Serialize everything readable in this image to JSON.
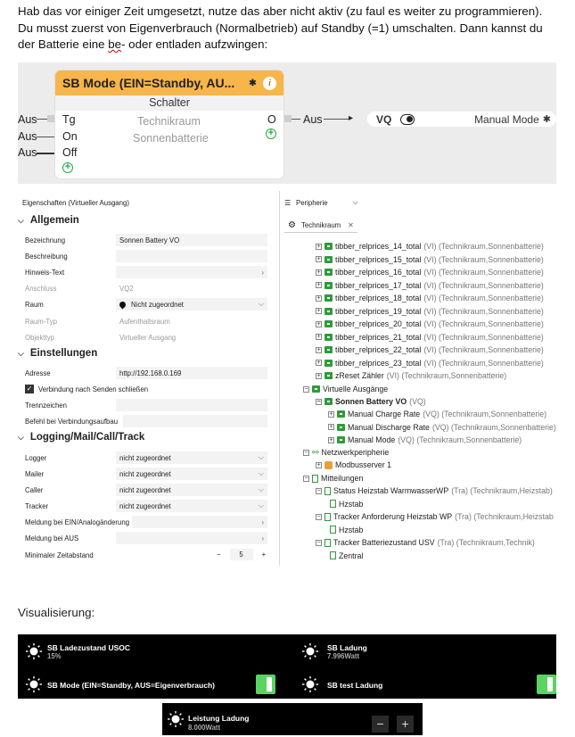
{
  "intro": {
    "line1": "Hab das vor einiger Zeit umgesetzt, nutze das aber nicht aktiv (zu faul es weiter zu programmieren).",
    "line2": "Du musst zuerst von Eigenverbrauch (Normalbetrieb) auf Standby (=1) umschalten. Dann kannst du",
    "line3_pre": "der Batterie eine ",
    "line3_ul": "be",
    "line3_post": "- oder entladen aufzwingen:"
  },
  "logic_block": {
    "title": "SB Mode (EIN=Standby, AU...",
    "subtitle": "Schalter",
    "inputs": [
      {
        "wire": "Aus",
        "pin": "Tg"
      },
      {
        "wire": "Aus",
        "pin": "On"
      },
      {
        "wire": "Aus",
        "pin": "Off"
      }
    ],
    "room": "Technikraum",
    "device": "Sonnenbatterie",
    "output_pin": "O",
    "output_wire": "Aus",
    "vq_label": "VQ",
    "vq_value": "Manual Mode"
  },
  "properties": {
    "title": "Eigenschaften (Virtueller Ausgang)",
    "sections": {
      "allgemein": "Allgemein",
      "einstellungen": "Einstellungen",
      "logging": "Logging/Mail/Call/Track"
    },
    "fields": {
      "bezeichnung": {
        "label": "Bezeichnung",
        "value": "Sonnen Battery VO"
      },
      "beschreibung": {
        "label": "Beschreibung",
        "value": ""
      },
      "hinweis": {
        "label": "Hinweis-Text",
        "value": ""
      },
      "anschluss": {
        "label": "Anschluss",
        "value": "VQ2"
      },
      "raum": {
        "label": "Raum",
        "value": "Nicht zugeordnet"
      },
      "raumtyp": {
        "label": "Raum-Typ",
        "value": "Aufenthaltsraum"
      },
      "objekttyp": {
        "label": "Objekttyp",
        "value": "Virtueller Ausgang"
      },
      "adresse": {
        "label": "Adresse",
        "value": "http://192.168.0.169"
      },
      "verbindung": {
        "label": "Verbindung nach Senden schließen",
        "checked": true
      },
      "trennzeichen": {
        "label": "Trennzeichen",
        "value": ""
      },
      "befehl": {
        "label": "Befehl bei Verbindungsaufbau",
        "value": ""
      },
      "logger": {
        "label": "Logger",
        "value": "nicht zugeordnet"
      },
      "mailer": {
        "label": "Mailer",
        "value": "nicht zugeordnet"
      },
      "caller": {
        "label": "Caller",
        "value": "nicht zugeordnet"
      },
      "tracker": {
        "label": "Tracker",
        "value": "nicht zugeordnet"
      },
      "meldung_ein": {
        "label": "Meldung bei EIN/Analogänderung",
        "value": ""
      },
      "meldung_aus": {
        "label": "Meldung bei AUS",
        "value": ""
      },
      "zeitabstand": {
        "label": "Minimaler Zeitabstand",
        "value": "5",
        "minus": "−",
        "plus": "+"
      }
    }
  },
  "tree": {
    "header": "Peripherie",
    "tab": "Technikraum",
    "items": [
      {
        "name": "tibber_relprices_14_total",
        "suffix": "(VI) (Technikraum,Sonnenbatterie)"
      },
      {
        "name": "tibber_relprices_15_total",
        "suffix": "(VI) (Technikraum,Sonnenbatterie)"
      },
      {
        "name": "tibber_relprices_16_total",
        "suffix": "(VI) (Technikraum,Sonnenbatterie)"
      },
      {
        "name": "tibber_relprices_17_total",
        "suffix": "(VI) (Technikraum,Sonnenbatterie)"
      },
      {
        "name": "tibber_relprices_18_total",
        "suffix": "(VI) (Technikraum,Sonnenbatterie)"
      },
      {
        "name": "tibber_relprices_19_total",
        "suffix": "(VI) (Technikraum,Sonnenbatterie)"
      },
      {
        "name": "tibber_relprices_20_total",
        "suffix": "(VI) (Technikraum,Sonnenbatterie)"
      },
      {
        "name": "tibber_relprices_21_total",
        "suffix": "(VI) (Technikraum,Sonnenbatterie)"
      },
      {
        "name": "tibber_relprices_22_total",
        "suffix": "(VI) (Technikraum,Sonnenbatterie)"
      },
      {
        "name": "tibber_relprices_23_total",
        "suffix": "(VI) (Technikraum,Sonnenbatterie)"
      },
      {
        "name": "zReset Zähler",
        "suffix": "(VI) (Technikraum,Sonnenbatterie)"
      }
    ],
    "virtual_outputs": "Virtuelle Ausgänge",
    "battery": "Sonnen Battery VO",
    "battery_suffix": "(VQ)",
    "commands": [
      {
        "name": "Manual Charge Rate",
        "suffix": "(VQ) (Technikraum,Sonnenbatterie)"
      },
      {
        "name": "Manual Discharge Rate",
        "suffix": "(VQ) (Technikraum,Sonnenbatterie)"
      },
      {
        "name": "Manual Mode",
        "suffix": "(VQ) (Technikraum,Sonnenbatterie)"
      }
    ],
    "network": "Netzwerkperipherie",
    "modbus": "Modbusserver 1",
    "messages": "Mitteilungen",
    "msg_items": [
      {
        "name": "Status Heizstab WarmwasserWP",
        "suffix": "(Tra) (Technikraum,Heizstab)",
        "child": "Hzstab"
      },
      {
        "name": "Tracker Anforderung Heizstab WP",
        "suffix": "(Tra) (Technikraum,Heizstab",
        "child": "Hzstab"
      },
      {
        "name": "Tracker Batteriezustand USV",
        "suffix": "(Tra) (Technikraum,Technik)",
        "child": "Zentral"
      }
    ]
  },
  "visual": {
    "label": "Visualisierung:",
    "tiles": [
      {
        "title": "SB Ladezustand USOC",
        "value": "15%"
      },
      {
        "title": "SB Ladung",
        "value": "7.996Watt"
      },
      {
        "title": "SB Mode (EIN=Standby, AUS=Eigenverbrauch)",
        "on": true
      },
      {
        "title": "SB test Ladung",
        "on": true
      },
      {
        "title": "Leistung Ladung",
        "value": "8.000Watt",
        "minus": "−",
        "plus": "+"
      }
    ]
  }
}
